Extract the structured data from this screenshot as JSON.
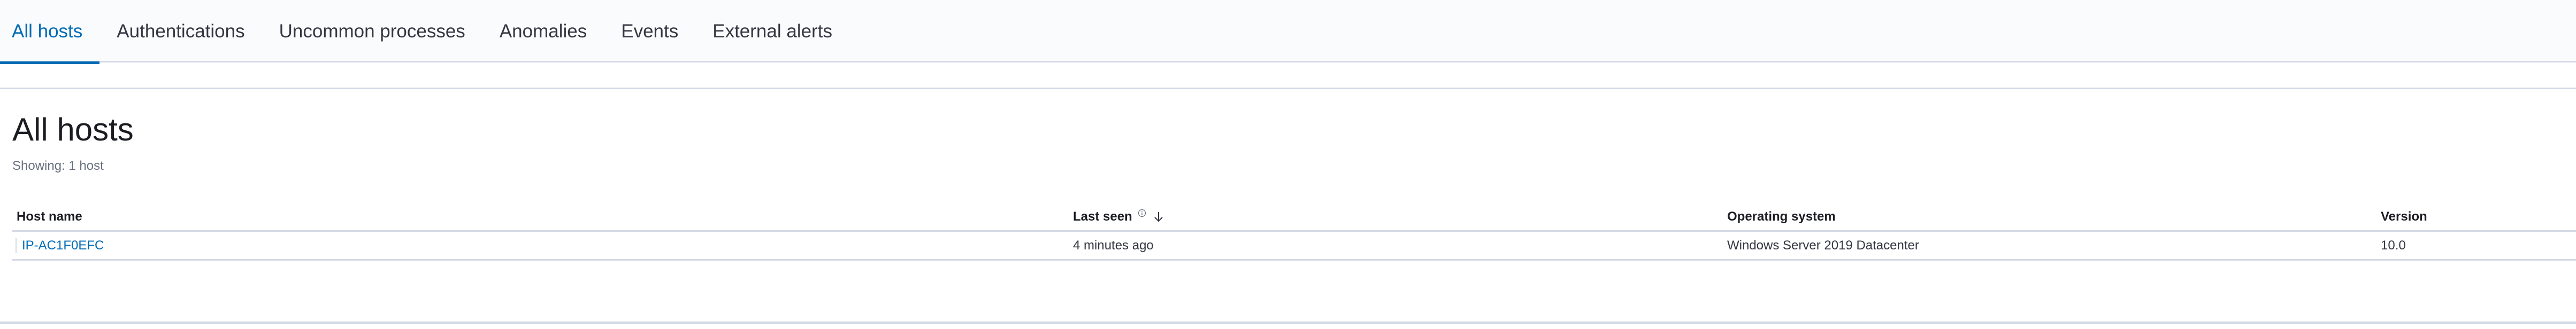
{
  "tabs": [
    {
      "label": "All hosts",
      "active": true
    },
    {
      "label": "Authentications",
      "active": false
    },
    {
      "label": "Uncommon processes",
      "active": false
    },
    {
      "label": "Anomalies",
      "active": false
    },
    {
      "label": "Events",
      "active": false
    },
    {
      "label": "External alerts",
      "active": false
    }
  ],
  "panel": {
    "title": "All hosts",
    "subtitle": "Showing: 1 host"
  },
  "table": {
    "columns": [
      {
        "label": "Host name"
      },
      {
        "label": "Last seen",
        "info_icon": "info-icon",
        "sort_icon": "arrow-down-icon",
        "sort": "descending"
      },
      {
        "label": "Operating system"
      },
      {
        "label": "Version"
      }
    ],
    "rows": [
      {
        "host_name": "IP-AC1F0EFC",
        "last_seen": "4 minutes ago",
        "os": "Windows Server 2019 Datacenter",
        "version": "10.0"
      }
    ]
  },
  "colors": {
    "accent": "#006bb4",
    "border": "#d3dae6",
    "text": "#343741",
    "muted": "#69707d"
  }
}
